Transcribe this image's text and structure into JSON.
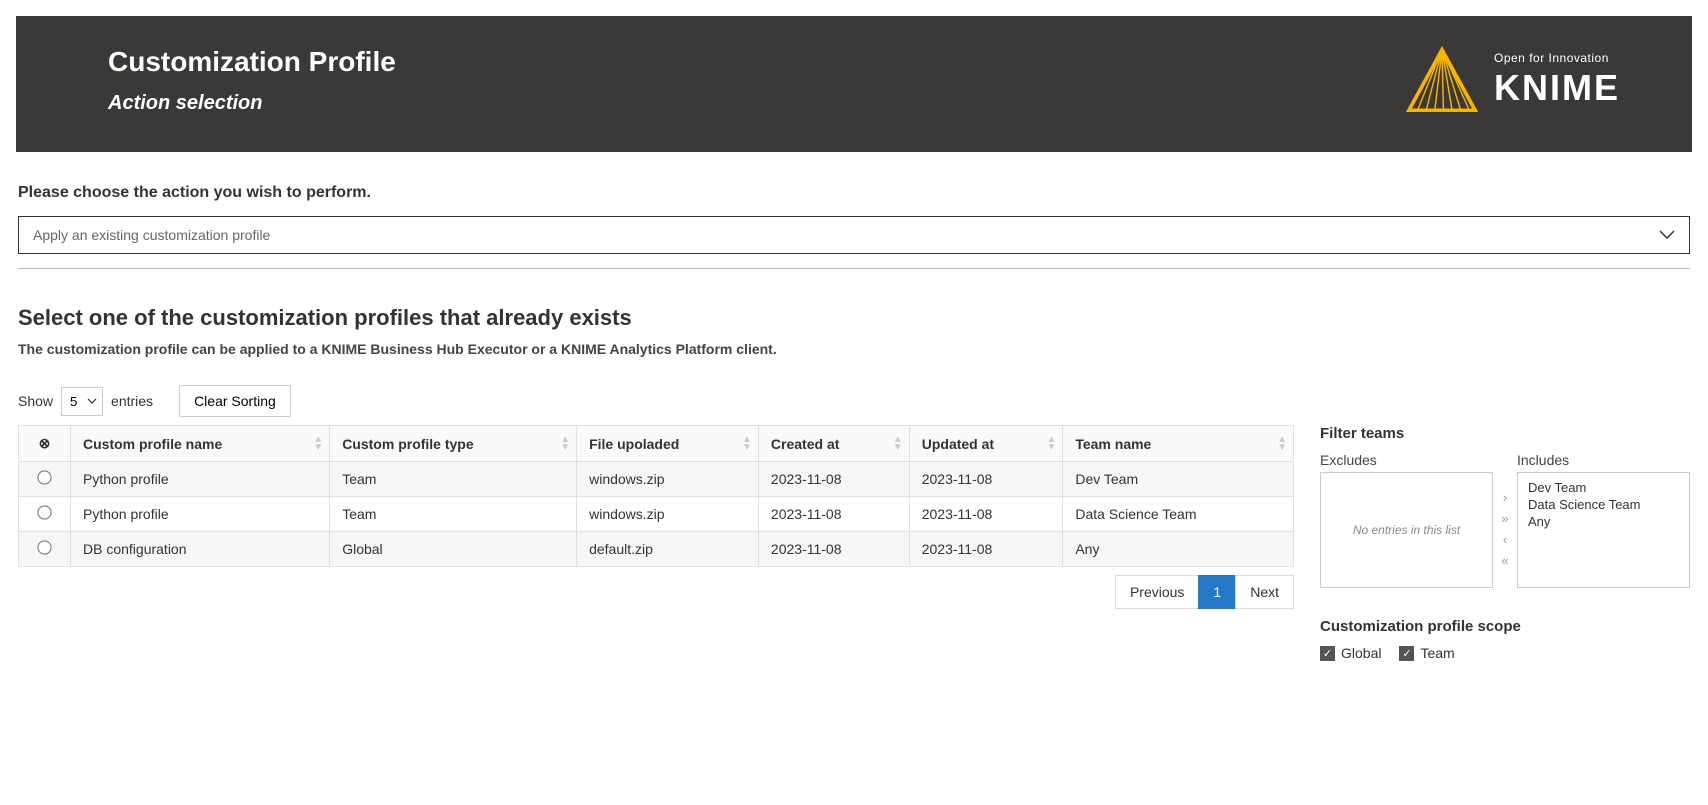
{
  "header": {
    "title": "Customization Profile",
    "subtitle": "Action selection",
    "brand_tagline": "Open for Innovation",
    "brand_name": "KNIME"
  },
  "action": {
    "prompt": "Please choose the action you wish to perform.",
    "selected": "Apply an existing customization profile"
  },
  "profiles": {
    "title": "Select one of the customization profiles that already exists",
    "desc": "The customization profile can be applied to a KNIME Business Hub Executor or a KNIME Analytics Platform client.",
    "show_label_pre": "Show",
    "show_value": "5",
    "show_label_post": "entries",
    "clear_sorting": "Clear Sorting",
    "columns": [
      "Custom profile name",
      "Custom profile type",
      "File upoladed",
      "Created at",
      "Updated at",
      "Team name"
    ],
    "rows": [
      {
        "name": "Python profile",
        "type": "Team",
        "file": "windows.zip",
        "created": "2023-11-08",
        "updated": "2023-11-08",
        "team": "Dev Team"
      },
      {
        "name": "Python profile",
        "type": "Team",
        "file": "windows.zip",
        "created": "2023-11-08",
        "updated": "2023-11-08",
        "team": "Data Science Team"
      },
      {
        "name": "DB configuration",
        "type": "Global",
        "file": "default.zip",
        "created": "2023-11-08",
        "updated": "2023-11-08",
        "team": "Any"
      }
    ],
    "pagination": {
      "prev": "Previous",
      "pages": [
        "1"
      ],
      "next": "Next"
    }
  },
  "filter": {
    "title": "Filter teams",
    "excludes_label": "Excludes",
    "includes_label": "Includes",
    "excludes_empty": "No entries in this list",
    "includes": [
      "Dev Team",
      "Data Science Team",
      "Any"
    ]
  },
  "scope": {
    "title": "Customization profile scope",
    "options": [
      {
        "label": "Global",
        "checked": true
      },
      {
        "label": "Team",
        "checked": true
      }
    ]
  }
}
